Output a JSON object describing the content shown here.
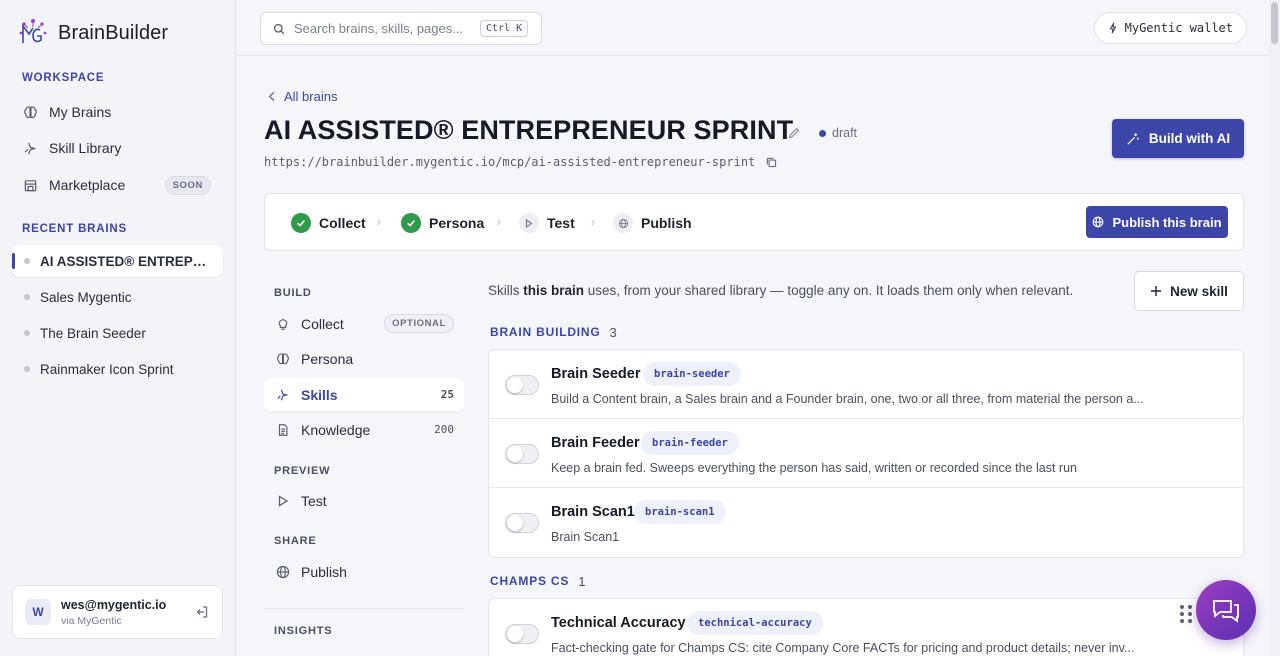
{
  "brand": {
    "name": "BrainBuilder",
    "logo_text": "MG"
  },
  "sidebar": {
    "workspace_label": "WORKSPACE",
    "items": [
      {
        "label": "My Brains",
        "icon": "brain-icon"
      },
      {
        "label": "Skill Library",
        "icon": "skill-icon"
      },
      {
        "label": "Marketplace",
        "icon": "store-icon",
        "badge": "SOON"
      }
    ],
    "recent_label": "RECENT BRAINS",
    "recent": [
      {
        "label": "AI ASSISTED® ENTREPRENEUR SPRINT",
        "active": true
      },
      {
        "label": "Sales Mygentic"
      },
      {
        "label": "The Brain Seeder"
      },
      {
        "label": "Rainmaker Icon Sprint"
      }
    ],
    "user": {
      "initial": "W",
      "email": "wes@mygentic.io",
      "via": "via MyGentic"
    }
  },
  "topbar": {
    "search_placeholder": "Search brains, skills, pages...",
    "shortcut": "Ctrl K",
    "wallet_label": "MyGentic wallet"
  },
  "brain": {
    "back_label": "All brains",
    "title": "AI ASSISTED® ENTREPRENEUR SPRINT",
    "status": "draft",
    "url": "https://brainbuilder.mygentic.io/mcp/ai-assisted-entrepreneur-sprint",
    "build_ai_label": "Build with AI"
  },
  "steps": {
    "items": [
      {
        "label": "Collect",
        "done": true
      },
      {
        "label": "Persona",
        "done": true
      },
      {
        "label": "Test",
        "done": false
      },
      {
        "label": "Publish",
        "done": false
      }
    ],
    "publish_label": "Publish this brain"
  },
  "nav": {
    "build_label": "BUILD",
    "build": [
      {
        "label": "Collect",
        "badge": "OPTIONAL"
      },
      {
        "label": "Persona"
      },
      {
        "label": "Skills",
        "count": "25",
        "active": true
      },
      {
        "label": "Knowledge",
        "count": "200"
      }
    ],
    "preview_label": "PREVIEW",
    "preview": [
      {
        "label": "Test"
      }
    ],
    "share_label": "SHARE",
    "share": [
      {
        "label": "Publish"
      }
    ],
    "insights_label": "INSIGHTS"
  },
  "skills": {
    "desc_prefix": "Skills ",
    "desc_bold": "this brain",
    "desc_suffix": " uses, from your shared library — toggle any on. It loads them only when relevant.",
    "new_skill_label": "New skill",
    "groups": [
      {
        "name": "BRAIN BUILDING",
        "count": "3",
        "skills": [
          {
            "name": "Brain Seeder",
            "tag": "brain-seeder",
            "desc": "Build a Content brain, a Sales brain and a Founder brain, one, two or all three, from material the person a...",
            "enabled": false
          },
          {
            "name": "Brain Feeder",
            "tag": "brain-feeder",
            "desc": "Keep a brain fed. Sweeps everything the person has said, written or recorded since the last run",
            "enabled": false
          },
          {
            "name": "Brain Scan1",
            "tag": "brain-scan1",
            "desc": "Brain Scan1",
            "enabled": false
          }
        ]
      },
      {
        "name": "CHAMPS CS",
        "count": "1",
        "skills": [
          {
            "name": "Technical Accuracy",
            "tag": "technical-accuracy",
            "desc": "Fact-checking gate for Champs CS: cite Company Core FACTs for pricing and product details; never inv...",
            "enabled": false
          }
        ]
      }
    ]
  },
  "colors": {
    "accent": "#3b46a8",
    "success": "#2f9a49",
    "fab_start": "#9b3dbf",
    "fab_end": "#5b2fb3"
  }
}
